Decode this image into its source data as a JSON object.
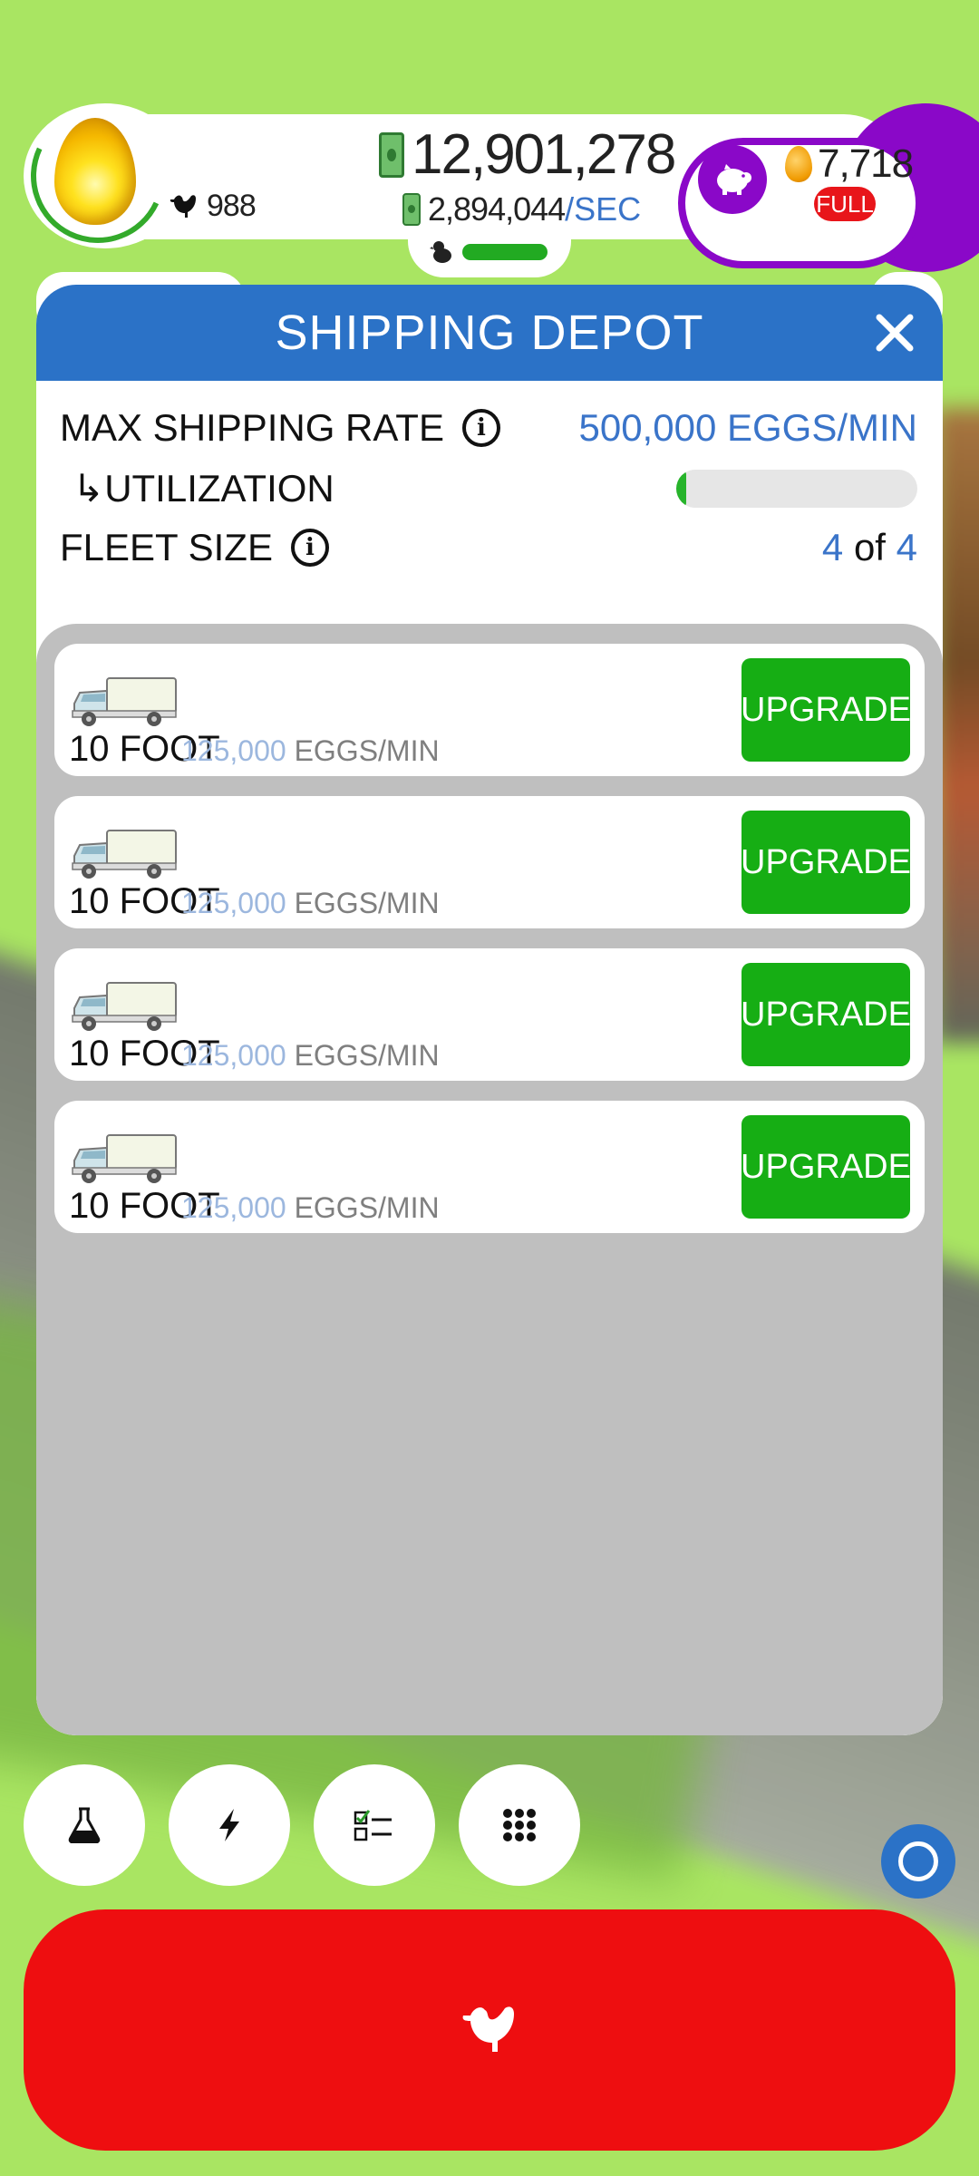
{
  "colors": {
    "background_grass": "#a9e562",
    "header_blue": "#2b72c7",
    "value_blue": "#3a74c9",
    "upgrade_green": "#16ae14",
    "hatch_red": "#ee0e10",
    "piggy_purple": "#8a08c8",
    "fleet_panel_gray": "#bfbfbf"
  },
  "hud": {
    "chicken_count": "988",
    "money": "12,901,278",
    "earn_rate": "2,894,044",
    "earn_rate_unit": "/SEC",
    "golden_eggs": "7,718",
    "piggy_status": "FULL",
    "icons": [
      "golden-egg-icon",
      "chicken-icon",
      "cash-icon",
      "piggy-bank-icon",
      "golden-egg-small-icon",
      "chick-icon"
    ]
  },
  "modal": {
    "title": "SHIPPING DEPOT",
    "close_icon": "close-icon",
    "max_rate_label": "MAX SHIPPING RATE",
    "max_rate_value": "500,000 EGGS/MIN",
    "utilization_label": "↳UTILIZATION",
    "utilization_fraction": 0.03,
    "fleet_label": "FLEET SIZE",
    "fleet_current": "4",
    "fleet_of": "of",
    "fleet_total": "4"
  },
  "vehicles": [
    {
      "name": "10 FOOT",
      "rate": "125,000",
      "unit": "EGGS/MIN",
      "button": "UPGRADE"
    },
    {
      "name": "10 FOOT",
      "rate": "125,000",
      "unit": "EGGS/MIN",
      "button": "UPGRADE"
    },
    {
      "name": "10 FOOT",
      "rate": "125,000",
      "unit": "EGGS/MIN",
      "button": "UPGRADE"
    },
    {
      "name": "10 FOOT",
      "rate": "125,000",
      "unit": "EGGS/MIN",
      "button": "UPGRADE"
    }
  ],
  "bottom": {
    "buttons": [
      "research-flask-icon",
      "boost-lightning-icon",
      "missions-checklist-icon",
      "menu-grid-icon"
    ],
    "hatch_icon": "chicken-icon",
    "floating_icon": "circle-icon"
  }
}
